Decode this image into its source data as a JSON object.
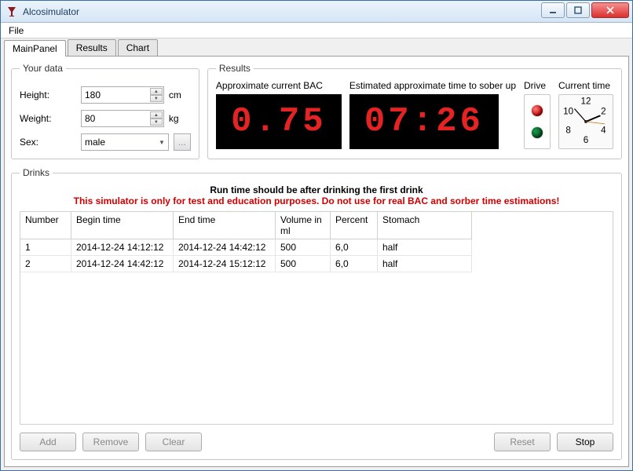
{
  "window": {
    "title": "Alcosimulator"
  },
  "menu": {
    "file": "File"
  },
  "tabs": {
    "main": "MainPanel",
    "results": "Results",
    "chart": "Chart"
  },
  "yourdata": {
    "legend": "Your data",
    "height_label": "Height:",
    "height_value": "180",
    "height_unit": "cm",
    "weight_label": "Weight:",
    "weight_value": "80",
    "weight_unit": "kg",
    "sex_label": "Sex:",
    "sex_value": "male",
    "more_btn": "..."
  },
  "results": {
    "legend": "Results",
    "bac_label": "Approximate current BAC",
    "bac_value": "0.75",
    "sober_label": "Estimated approximate time to sober up",
    "sober_value": "07:26",
    "drive_label": "Drive",
    "clock_label": "Current time",
    "clock_numbers": {
      "n12": "12",
      "n2": "2",
      "n4": "4",
      "n6": "6",
      "n8": "8",
      "n10": "10"
    }
  },
  "drinks": {
    "legend": "Drinks",
    "hint1": "Run time should be after drinking the first drink",
    "hint2": "This simulator is only for test and education purposes. Do not use for real BAC and sorber time estimations!",
    "headers": {
      "num": "Number",
      "begin": "Begin time",
      "end": "End time",
      "vol": "Volume in ml",
      "pct": "Percent",
      "sto": "Stomach"
    },
    "rows": [
      {
        "num": "1",
        "begin": "2014-12-24 14:12:12",
        "end": "2014-12-24 14:42:12",
        "vol": "500",
        "pct": "6,0",
        "sto": "half"
      },
      {
        "num": "2",
        "begin": "2014-12-24 14:42:12",
        "end": "2014-12-24 15:12:12",
        "vol": "500",
        "pct": "6,0",
        "sto": "half"
      }
    ]
  },
  "buttons": {
    "add": "Add",
    "remove": "Remove",
    "clear": "Clear",
    "reset": "Reset",
    "stop": "Stop"
  }
}
